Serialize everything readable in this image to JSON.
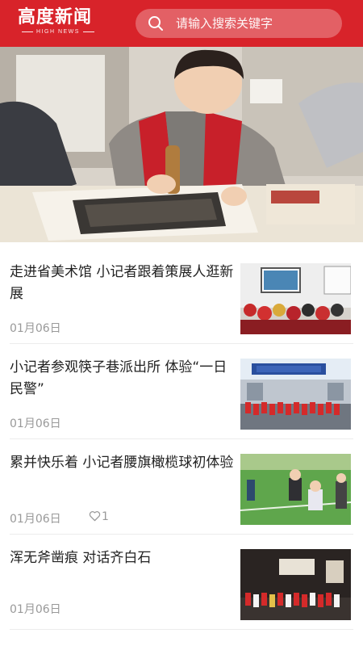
{
  "header": {
    "logo_main": "高度新闻",
    "logo_sub": "HIGH NEWS",
    "search_placeholder": "请输入搜索关键字",
    "brand_color": "#d8232a"
  },
  "hero": {
    "image": "child-printing-woodblock-photo"
  },
  "articles": [
    {
      "title": "走进省美术馆 小记者跟着策展人逛新展",
      "date": "01月06日",
      "likes": "",
      "thumb": "museum-visit-photo"
    },
    {
      "title": "小记者参观筷子巷派出所 体验“一日民警”",
      "date": "01月06日",
      "likes": "",
      "thumb": "police-station-photo"
    },
    {
      "title": "累并快乐着 小记者腰旗橄榄球初体验",
      "date": "01月06日",
      "likes": "1",
      "thumb": "flag-football-photo"
    },
    {
      "title": "浑无斧凿痕 对话齐白石",
      "date": "01月06日",
      "likes": "",
      "thumb": "art-exhibit-photo"
    }
  ],
  "icons": {
    "search": "search-icon",
    "like": "heart-icon"
  }
}
